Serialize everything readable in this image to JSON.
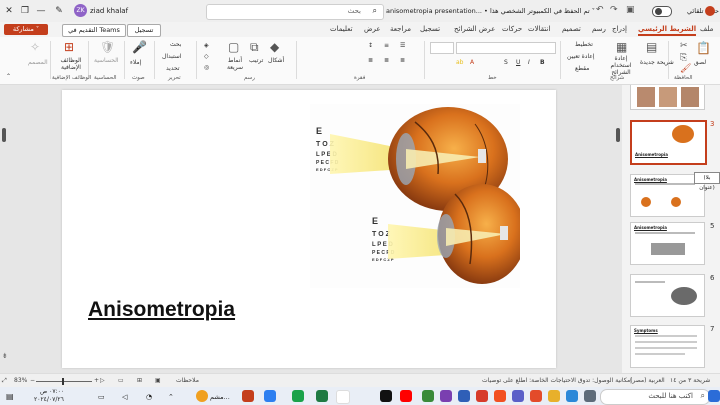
{
  "titlebar": {
    "user_initials": "ZK",
    "user_name": "ziad khalaf",
    "search_placeholder": "بحث",
    "doc_title": "anisometropia presentation... • تم الحفظ في الكمبيوتر الشخصي هذا ˅",
    "autosave_label": "حفظ تلقائي"
  },
  "tabs": [
    "ملف",
    "الشريط الرئيسي",
    "إدراج",
    "رسم",
    "تصميم",
    "انتقالات",
    "حركات",
    "عرض الشرائح",
    "تسجيل",
    "مراجعة",
    "عرض",
    "تعليمات"
  ],
  "active_tab": "الشريط الرئيسي",
  "actions": {
    "share": "مشاركة ˅",
    "teams": "التقديم في Teams",
    "record": "تسجيل"
  },
  "ribbon": {
    "paste": "لصق",
    "clipboard": "الحافظة",
    "new_slide": "شريحة جديدة",
    "reuse": "إعادة استخدام الشرائح",
    "slides_group": "شرائح",
    "layout": "تخطيط",
    "reset": "إعادة تعيين",
    "section": "مقطع",
    "font_group": "خط",
    "para_group": "فقرة",
    "shapes": "أشكال",
    "arrange": "ترتيب",
    "quick_styles": "أنماط سريعة",
    "drawing_group": "رسم",
    "find": "بحث",
    "replace": "استبدال",
    "select": "تحديد",
    "editing_group": "تحرير",
    "dictate": "إملاء",
    "voice_group": "صوت",
    "sensitivity": "الحساسية",
    "sensitivity_group": "الحساسية",
    "addins": "الوظائف الإضافية",
    "addins_group": "الوظائف الإضافية",
    "designer": "المصمم"
  },
  "slide": {
    "title": "Anisometropia"
  },
  "thumbnails": [
    {
      "number": "3",
      "caption": "Anisometropia"
    },
    {
      "number": "4",
      "caption": "Anisometropia"
    },
    {
      "number": "5",
      "caption": "Anisometropia"
    },
    {
      "number": "6",
      "caption": ""
    },
    {
      "number": "7",
      "caption": "Symptoms"
    }
  ],
  "tooltip": "(بلا عنوان)",
  "statusbar": {
    "slide_info": "شريحة ٣ من ١٤",
    "language": "العربية (مصر)",
    "accessibility": "إمكانية الوصول: تدوق الاحتياجات الخاصة: اطلع على توصيات",
    "notes": "ملاحظات",
    "zoom": "83%"
  },
  "taskbar": {
    "search": "اكتب هنا للبحث",
    "weather": "مشم...",
    "time": "٠٧:٠٠ ص",
    "date": "٢٠٢٤/٠٧/٢٦"
  },
  "colors": {
    "accent": "#c43e1c",
    "eye_orange": "#d9711d",
    "beam": "#f3e06a"
  }
}
